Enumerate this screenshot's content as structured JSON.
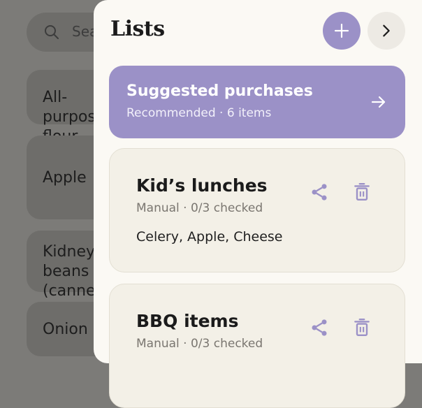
{
  "background": {
    "search_placeholder": "Search",
    "items": [
      "All-purpose flour",
      "Apple",
      "Kidney beans\n(canned)",
      "Onion"
    ]
  },
  "panel": {
    "title": "Lists",
    "add_icon": "plus-icon",
    "next_icon": "chevron-right-icon"
  },
  "suggested": {
    "title": "Suggested purchases",
    "subtitle": "Recommended · 6 items",
    "icon": "arrow-right-icon"
  },
  "lists": [
    {
      "name": "Kid’s lunches",
      "meta": "Manual · 0/3 checked",
      "items": "Celery, Apple, Cheese"
    },
    {
      "name": "BBQ items",
      "meta": "Manual · 0/3 checked",
      "items": ""
    }
  ],
  "colors": {
    "accent": "#9b91c7",
    "panel_bg": "#fbf9f4",
    "card_bg": "#f3f0e7",
    "overlay": "#7c7b78"
  }
}
